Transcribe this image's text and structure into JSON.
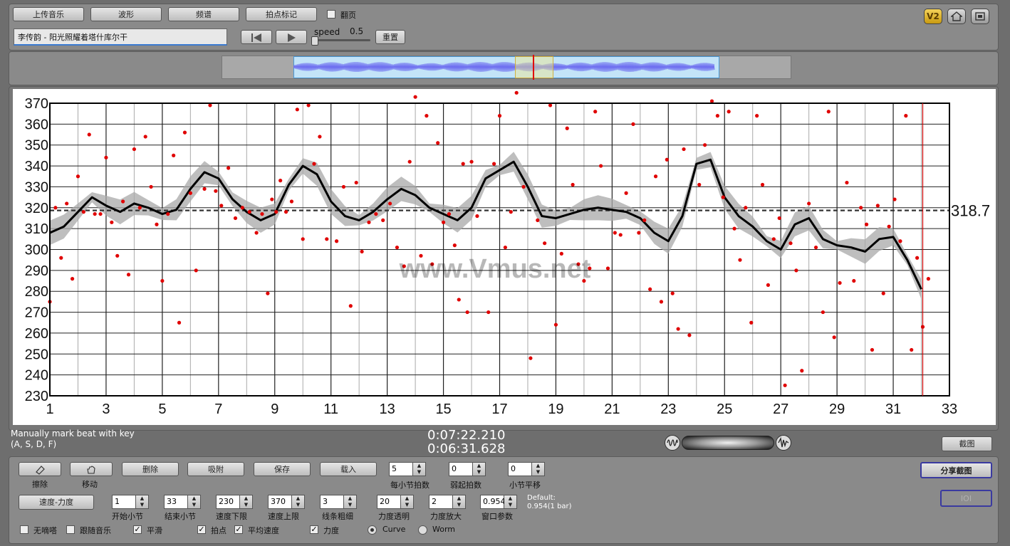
{
  "toolbar": {
    "upload_label": "上传音乐",
    "waveform_label": "波形",
    "spectrum_label": "频谱",
    "beat_mark_label": "拍点标记",
    "page_turn_label": "翻页",
    "track_name": "李传韵 - 阳光照耀着塔什库尔干",
    "speed_label": "speed",
    "speed_value": "0.5",
    "reset_label": "重置"
  },
  "overlay_text": "www.Vmus.net",
  "status": {
    "hint_line1": "Manually mark beat with key",
    "hint_line2": "(A, S, D, F)",
    "time_total": "0:07:22.210",
    "time_current": "0:06:31.628",
    "screenshot_label": "截图"
  },
  "controls": {
    "erase_label": "擦除",
    "move_label": "移动",
    "delete_label": "删除",
    "snap_label": "吸附",
    "save_label": "保存",
    "load_label": "载入",
    "beats_per_bar_value": "5",
    "beats_per_bar_label": "每小节拍数",
    "pickup_value": "0",
    "pickup_label": "弱起拍数",
    "bar_shift_value": "0",
    "bar_shift_label": "小节平移",
    "share_label": "分享截图",
    "ioi_label": "IOI",
    "tempo_dynamics_label": "速度-力度",
    "start_bar_value": "1",
    "start_bar_label": "开始小节",
    "end_bar_value": "33",
    "end_bar_label": "结束小节",
    "tempo_min_value": "230",
    "tempo_min_label": "速度下限",
    "tempo_max_value": "370",
    "tempo_max_label": "速度上限",
    "line_width_value": "3",
    "line_width_label": "线条粗细",
    "dyn_alpha_value": "20",
    "dyn_alpha_label": "力度透明",
    "dyn_scale_value": "2",
    "dyn_scale_label": "力度放大",
    "window_value": "0.954",
    "window_label": "窗口参数",
    "default_line1": "Default:",
    "default_line2": "0.954(1 bar)",
    "no_metronome_label": "无嘀嗒",
    "follow_music_label": "跟随音乐",
    "smooth_label": "平滑",
    "beat_point_label": "拍点",
    "avg_tempo_label": "平均速度",
    "dynamics_label": "力度",
    "curve_label": "Curve",
    "worm_label": "Worm"
  },
  "chart_data": {
    "type": "scatter",
    "title": "",
    "xlabel": "",
    "ylabel": "",
    "xlim": [
      1,
      33
    ],
    "ylim": [
      230,
      370
    ],
    "x_ticks": [
      1,
      3,
      5,
      7,
      9,
      11,
      13,
      15,
      17,
      19,
      21,
      23,
      25,
      27,
      29,
      31,
      33
    ],
    "y_ticks": [
      230,
      240,
      250,
      260,
      270,
      280,
      290,
      300,
      310,
      320,
      330,
      340,
      350,
      360,
      370
    ],
    "average_tempo": 318.7,
    "average_label": "318.7",
    "grid": true,
    "playhead_bar": 32.05,
    "colors": {
      "points": "#e00000",
      "curve": "#000000",
      "band": "#a8a8a8",
      "average": "#333333",
      "playhead": "#cc0000"
    },
    "series": [
      {
        "type": "scatter",
        "points": [
          [
            1.0,
            275
          ],
          [
            1.2,
            320
          ],
          [
            1.4,
            296
          ],
          [
            1.6,
            322
          ],
          [
            1.8,
            286
          ],
          [
            2.0,
            335
          ],
          [
            2.2,
            318
          ],
          [
            2.4,
            355
          ],
          [
            2.6,
            317
          ],
          [
            2.8,
            317
          ],
          [
            3.0,
            344
          ],
          [
            3.2,
            313
          ],
          [
            3.4,
            297
          ],
          [
            3.6,
            323
          ],
          [
            3.8,
            288
          ],
          [
            4.0,
            348
          ],
          [
            4.2,
            320
          ],
          [
            4.4,
            354
          ],
          [
            4.6,
            330
          ],
          [
            4.8,
            312
          ],
          [
            5.0,
            285
          ],
          [
            5.2,
            317
          ],
          [
            5.4,
            345
          ],
          [
            5.6,
            265
          ],
          [
            5.8,
            356
          ],
          [
            6.0,
            327
          ],
          [
            6.2,
            290
          ],
          [
            6.5,
            329
          ],
          [
            6.7,
            369
          ],
          [
            6.9,
            328
          ],
          [
            7.1,
            321
          ],
          [
            7.35,
            339
          ],
          [
            7.6,
            315
          ],
          [
            7.85,
            320
          ],
          [
            8.1,
            318
          ],
          [
            8.35,
            308
          ],
          [
            8.55,
            317
          ],
          [
            8.75,
            279
          ],
          [
            8.9,
            324
          ],
          [
            9.05,
            318
          ],
          [
            9.2,
            333
          ],
          [
            9.4,
            318
          ],
          [
            9.6,
            323
          ],
          [
            9.8,
            367
          ],
          [
            10.0,
            305
          ],
          [
            10.2,
            369
          ],
          [
            10.4,
            341
          ],
          [
            10.6,
            354
          ],
          [
            10.85,
            305
          ],
          [
            11.2,
            304
          ],
          [
            11.45,
            330
          ],
          [
            11.7,
            273
          ],
          [
            11.9,
            332
          ],
          [
            12.1,
            299
          ],
          [
            12.35,
            313
          ],
          [
            12.6,
            317
          ],
          [
            12.85,
            314
          ],
          [
            13.1,
            322
          ],
          [
            13.35,
            301
          ],
          [
            13.6,
            292
          ],
          [
            13.8,
            342
          ],
          [
            14.0,
            373
          ],
          [
            14.2,
            297
          ],
          [
            14.4,
            364
          ],
          [
            14.6,
            293
          ],
          [
            14.8,
            351
          ],
          [
            15.0,
            313
          ],
          [
            15.2,
            317
          ],
          [
            15.4,
            302
          ],
          [
            15.55,
            276
          ],
          [
            15.7,
            341
          ],
          [
            15.85,
            270
          ],
          [
            16.0,
            342
          ],
          [
            16.2,
            316
          ],
          [
            16.6,
            270
          ],
          [
            16.8,
            341
          ],
          [
            17.0,
            364
          ],
          [
            17.2,
            301
          ],
          [
            17.4,
            318
          ],
          [
            17.6,
            375
          ],
          [
            17.85,
            330
          ],
          [
            18.1,
            248
          ],
          [
            18.35,
            314
          ],
          [
            18.6,
            303
          ],
          [
            18.8,
            369
          ],
          [
            19.0,
            264
          ],
          [
            19.2,
            298
          ],
          [
            19.4,
            358
          ],
          [
            19.6,
            331
          ],
          [
            19.8,
            293
          ],
          [
            20.0,
            285
          ],
          [
            20.2,
            291
          ],
          [
            20.4,
            366
          ],
          [
            20.6,
            340
          ],
          [
            20.85,
            291
          ],
          [
            21.1,
            308
          ],
          [
            21.3,
            307
          ],
          [
            21.5,
            327
          ],
          [
            21.75,
            360
          ],
          [
            21.95,
            308
          ],
          [
            22.15,
            314
          ],
          [
            22.35,
            281
          ],
          [
            22.55,
            335
          ],
          [
            22.75,
            275
          ],
          [
            22.95,
            343
          ],
          [
            23.15,
            279
          ],
          [
            23.35,
            262
          ],
          [
            23.55,
            348
          ],
          [
            23.75,
            259
          ],
          [
            24.1,
            331
          ],
          [
            24.3,
            350
          ],
          [
            24.55,
            371
          ],
          [
            24.75,
            364
          ],
          [
            24.95,
            325
          ],
          [
            25.15,
            366
          ],
          [
            25.35,
            310
          ],
          [
            25.55,
            295
          ],
          [
            25.75,
            320
          ],
          [
            25.95,
            265
          ],
          [
            26.15,
            364
          ],
          [
            26.35,
            331
          ],
          [
            26.55,
            283
          ],
          [
            26.75,
            305
          ],
          [
            26.95,
            315
          ],
          [
            27.15,
            235
          ],
          [
            27.35,
            303
          ],
          [
            27.55,
            290
          ],
          [
            27.75,
            242
          ],
          [
            28.0,
            322
          ],
          [
            28.25,
            301
          ],
          [
            28.5,
            270
          ],
          [
            28.7,
            366
          ],
          [
            28.9,
            258
          ],
          [
            29.1,
            284
          ],
          [
            29.35,
            332
          ],
          [
            29.6,
            285
          ],
          [
            29.85,
            320
          ],
          [
            30.05,
            312
          ],
          [
            30.25,
            252
          ],
          [
            30.45,
            321
          ],
          [
            30.65,
            279
          ],
          [
            30.85,
            311
          ],
          [
            31.05,
            324
          ],
          [
            31.25,
            304
          ],
          [
            31.45,
            364
          ],
          [
            31.65,
            252
          ],
          [
            31.85,
            296
          ],
          [
            32.05,
            263
          ],
          [
            32.25,
            286
          ]
        ]
      },
      {
        "type": "line",
        "name": "",
        "points": [
          [
            1.0,
            308
          ],
          [
            1.5,
            311
          ],
          [
            2.0,
            318
          ],
          [
            2.5,
            325
          ],
          [
            3.0,
            321
          ],
          [
            3.5,
            318
          ],
          [
            4.0,
            322
          ],
          [
            4.5,
            320
          ],
          [
            5.0,
            317
          ],
          [
            5.5,
            319
          ],
          [
            6.0,
            329
          ],
          [
            6.5,
            337
          ],
          [
            7.0,
            334
          ],
          [
            7.5,
            324
          ],
          [
            8.0,
            318
          ],
          [
            8.5,
            314
          ],
          [
            9.0,
            317
          ],
          [
            9.5,
            331
          ],
          [
            10.0,
            340
          ],
          [
            10.5,
            336
          ],
          [
            11.0,
            323
          ],
          [
            11.5,
            316
          ],
          [
            12.0,
            314
          ],
          [
            12.5,
            318
          ],
          [
            13.0,
            324
          ],
          [
            13.5,
            329
          ],
          [
            14.0,
            326
          ],
          [
            14.5,
            320
          ],
          [
            15.0,
            317
          ],
          [
            15.5,
            314
          ],
          [
            16.0,
            320
          ],
          [
            16.5,
            334
          ],
          [
            17.0,
            338
          ],
          [
            17.5,
            342
          ],
          [
            18.0,
            330
          ],
          [
            18.5,
            316
          ],
          [
            19.0,
            315
          ],
          [
            19.5,
            317
          ],
          [
            20.0,
            319
          ],
          [
            20.5,
            320
          ],
          [
            21.0,
            319
          ],
          [
            21.5,
            318
          ],
          [
            22.0,
            315
          ],
          [
            22.5,
            308
          ],
          [
            23.0,
            304
          ],
          [
            23.5,
            316
          ],
          [
            24.0,
            341
          ],
          [
            24.5,
            343
          ],
          [
            25.0,
            325
          ],
          [
            25.5,
            316
          ],
          [
            26.0,
            311
          ],
          [
            26.5,
            304
          ],
          [
            27.0,
            300
          ],
          [
            27.5,
            312
          ],
          [
            28.0,
            315
          ],
          [
            28.5,
            305
          ],
          [
            29.0,
            302
          ],
          [
            29.5,
            301
          ],
          [
            30.0,
            299
          ],
          [
            30.5,
            305
          ],
          [
            31.0,
            306
          ],
          [
            31.5,
            295
          ],
          [
            32.0,
            281
          ]
        ]
      }
    ]
  }
}
